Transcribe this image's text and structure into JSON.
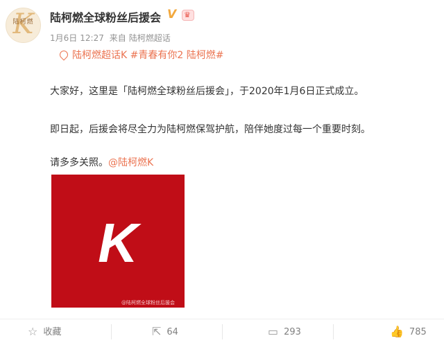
{
  "account": {
    "name": "陆柯燃全球粉丝后援会",
    "avatar_text": "陆柯燃",
    "avatar_letter": "K"
  },
  "post": {
    "date": "1月6日",
    "time": "12:27",
    "source_prefix": "来自",
    "source": "陆柯燃超话",
    "topics": "陆柯燃超话K #青春有你2 陆柯燃#",
    "paragraph1": "大家好，这里是「陆柯燃全球粉丝后援会」，于2020年1月6日正式成立。",
    "paragraph2": "即日起，后援会将尽全力为陆柯燃保驾护航，陪伴她度过每一个重要时刻。",
    "paragraph3_text": "请多多关照。",
    "mention": "@陆柯燃K",
    "image_letter": "K",
    "image_watermark": "@陆柯燃全球粉丝后援会"
  },
  "actions": {
    "favorite_label": "收藏",
    "repost_count": "64",
    "comment_count": "293",
    "like_count": "785"
  },
  "colors": {
    "accent": "#eb7350",
    "image_bg": "#c00d17",
    "badge": "#f2a83d"
  },
  "icons": {
    "favorite": "star-icon",
    "repost": "share-icon",
    "comment": "comment-icon",
    "like": "thumbs-up-icon",
    "verified": "verified-badge-icon",
    "vip": "vip-crown-icon",
    "topic": "flame-icon"
  }
}
